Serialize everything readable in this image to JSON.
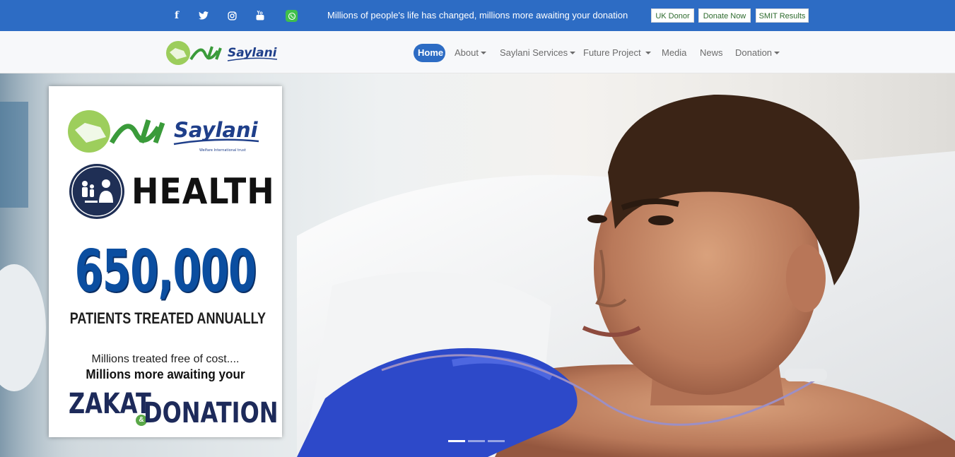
{
  "topbar": {
    "social": [
      {
        "icon": "facebook-icon",
        "glyph": "f"
      },
      {
        "icon": "twitter-icon",
        "glyph": "🐦"
      },
      {
        "icon": "instagram-icon",
        "glyph": "◎"
      },
      {
        "icon": "youtube-icon",
        "glyph": "▶"
      },
      {
        "icon": "whatsapp-icon",
        "glyph": "✆"
      }
    ],
    "message": "Millions of people's life has changed, millions more awaiting your donation",
    "buttons": {
      "uk_donor": "UK Donor",
      "donate_now": "Donate Now",
      "smit_results": "SMIT Results"
    },
    "colors": {
      "background": "#2d6cc4",
      "whatsapp": "#3fbf4b"
    }
  },
  "navbar": {
    "logo_text": "Saylani",
    "items": [
      {
        "label": "Home",
        "active": true,
        "dropdown": false
      },
      {
        "label": "About",
        "active": false,
        "dropdown": true
      },
      {
        "label": "Saylani Services",
        "active": false,
        "dropdown": true
      },
      {
        "label": "Future Project",
        "active": false,
        "dropdown": true
      },
      {
        "label": "Media",
        "active": false,
        "dropdown": false
      },
      {
        "label": "News",
        "active": false,
        "dropdown": false
      },
      {
        "label": "Donation",
        "active": false,
        "dropdown": true
      }
    ],
    "colors": {
      "active_bg": "#2d6cc4",
      "text": "#6c6c6c"
    }
  },
  "hero": {
    "card": {
      "logo_text": "Saylani",
      "logo_tagline": "Welfare International trust",
      "category": "HEALTH",
      "stat_value": "650,000",
      "stat_label": "PATIENTS TREATED ANNUALLY",
      "line1": "Millions treated free of cost....",
      "line2": "Millions more awaiting your",
      "zakat": "ZAKAT",
      "ampersand": "&",
      "donation": "DONATION"
    },
    "carousel": {
      "slides": 3,
      "active_index": 0
    }
  }
}
